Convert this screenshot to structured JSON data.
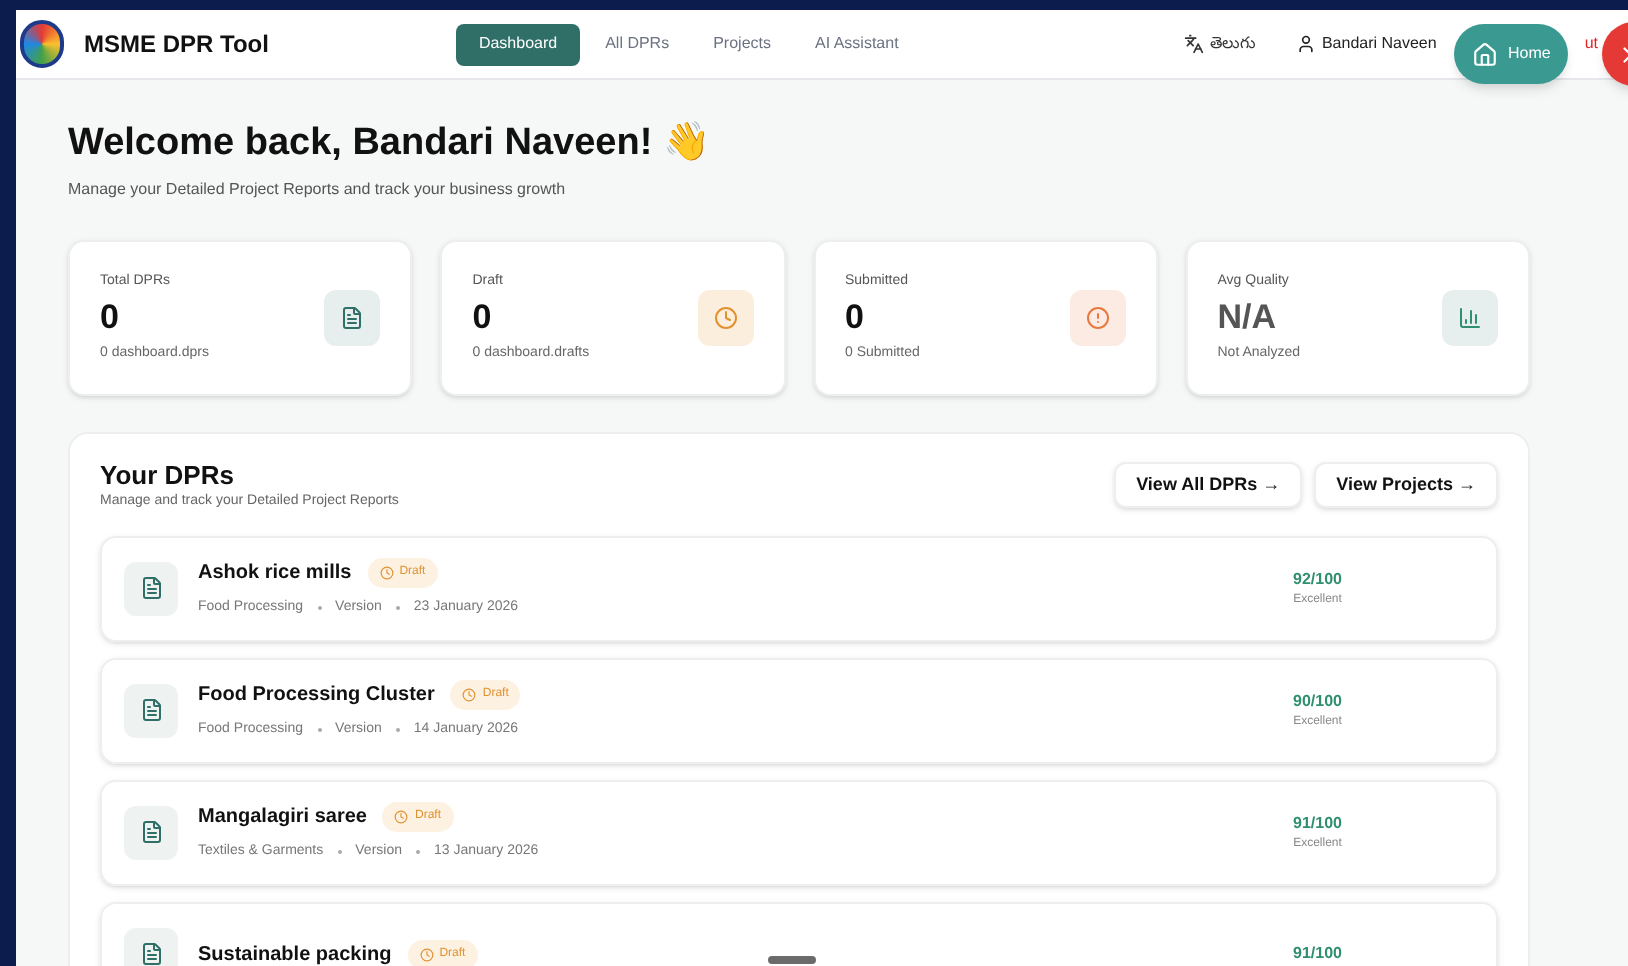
{
  "nav": {
    "brand": "MSME DPR Tool",
    "tabs": [
      {
        "label": "Dashboard",
        "selected": true
      },
      {
        "label": "All DPRs",
        "selected": false
      },
      {
        "label": "Projects",
        "selected": false
      },
      {
        "label": "AI Assistant",
        "selected": false
      }
    ],
    "language": "తెలుగు",
    "user": "Bandari Naveen",
    "logout_fragment": "ut"
  },
  "floating": {
    "home": "Home"
  },
  "welcome": {
    "title": "Welcome back, Bandari Naveen! 👋",
    "subtitle": "Manage your Detailed Project Reports and track your business growth"
  },
  "stats": [
    {
      "kind": "document",
      "label": "Total DPRs",
      "value": "0",
      "note": "0 dashboard.dprs"
    },
    {
      "kind": "clock",
      "label": "Draft",
      "value": "0",
      "note": "0 dashboard.drafts"
    },
    {
      "kind": "alert",
      "label": "Submitted",
      "value": "0",
      "note": "0 Submitted"
    },
    {
      "kind": "chart",
      "label": "Avg Quality",
      "value": "N/A",
      "note": "Not Analyzed"
    }
  ],
  "dprs": {
    "title": "Your DPRs",
    "subtitle": "Manage and track your Detailed Project Reports",
    "buttons": [
      "View All DPRs →",
      "View Projects →"
    ],
    "rows": [
      {
        "name": "Ashok rice mills",
        "status": "Draft",
        "sector": "Food Processing",
        "version": "Version",
        "date": "23 January 2026",
        "score": "92/100",
        "rating": "Excellent"
      },
      {
        "name": "Food Processing Cluster",
        "status": "Draft",
        "sector": "Food Processing",
        "version": "Version",
        "date": "14 January 2026",
        "score": "90/100",
        "rating": "Excellent"
      },
      {
        "name": "Mangalagiri saree",
        "status": "Draft",
        "sector": "Textiles & Garments",
        "version": "Version",
        "date": "13 January 2026",
        "score": "91/100",
        "rating": "Excellent"
      },
      {
        "name": "Sustainable packing",
        "status": "Draft",
        "score": "91/100"
      }
    ]
  }
}
